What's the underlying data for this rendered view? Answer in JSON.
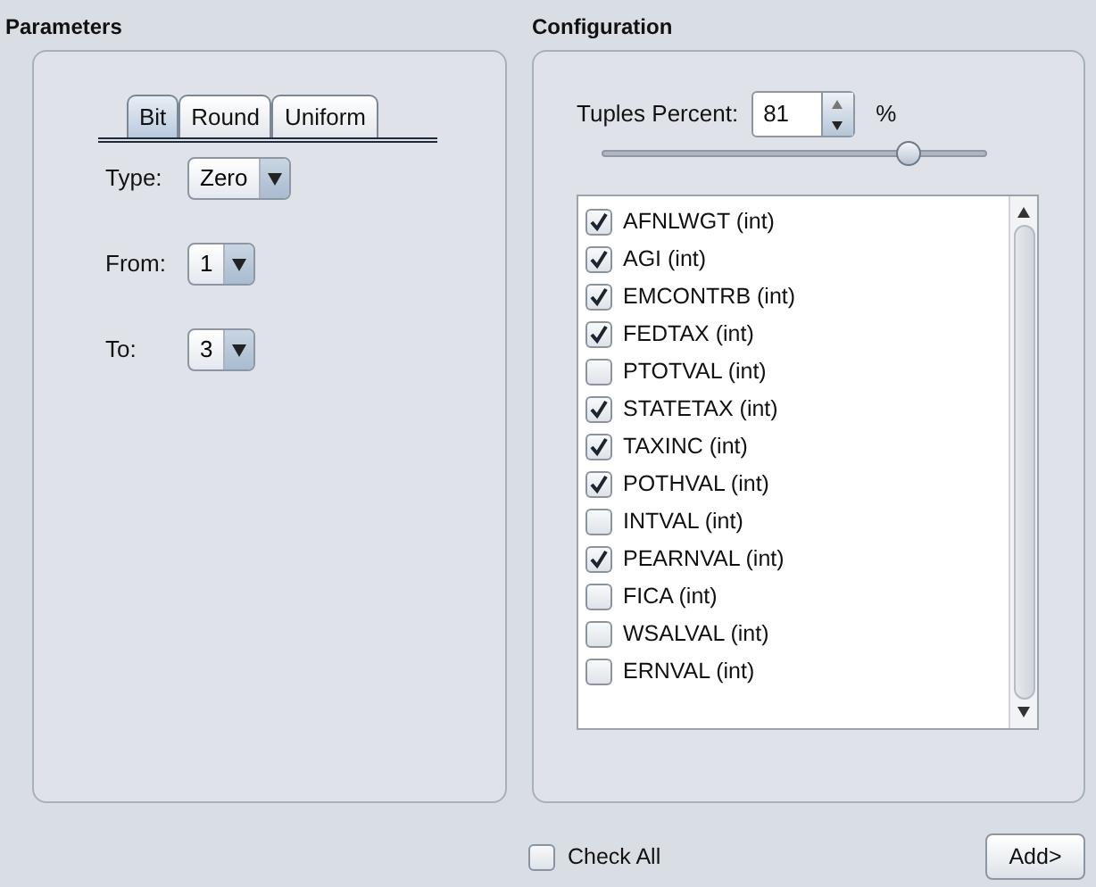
{
  "parameters": {
    "title": "Parameters",
    "tabs": [
      {
        "label": "Bit",
        "selected": true
      },
      {
        "label": "Round",
        "selected": false
      },
      {
        "label": "Uniform",
        "selected": false
      }
    ],
    "fields": [
      {
        "label": "Type:",
        "value": "Zero"
      },
      {
        "label": "From:",
        "value": "1"
      },
      {
        "label": "To:",
        "value": "3"
      }
    ]
  },
  "configuration": {
    "title": "Configuration",
    "tuples_label": "Tuples Percent:",
    "tuples_value": "81",
    "unit": "%",
    "slider": {
      "level": 0.8
    },
    "columns": [
      {
        "label": "AFNLWGT (int)",
        "checked": true
      },
      {
        "label": "AGI (int)",
        "checked": true
      },
      {
        "label": "EMCONTRB (int)",
        "checked": true
      },
      {
        "label": "FEDTAX (int)",
        "checked": true
      },
      {
        "label": "PTOTVAL (int)",
        "checked": false
      },
      {
        "label": "STATETAX (int)",
        "checked": true
      },
      {
        "label": "TAXINC (int)",
        "checked": true
      },
      {
        "label": "POTHVAL (int)",
        "checked": true
      },
      {
        "label": "INTVAL (int)",
        "checked": false
      },
      {
        "label": "PEARNVAL (int)",
        "checked": true
      },
      {
        "label": "FICA (int)",
        "checked": false
      },
      {
        "label": "WSALVAL (int)",
        "checked": false
      },
      {
        "label": "ERNVAL (int)",
        "checked": false
      }
    ]
  },
  "check_all": {
    "label": "Check All",
    "checked": false
  },
  "add_button": "Add>"
}
